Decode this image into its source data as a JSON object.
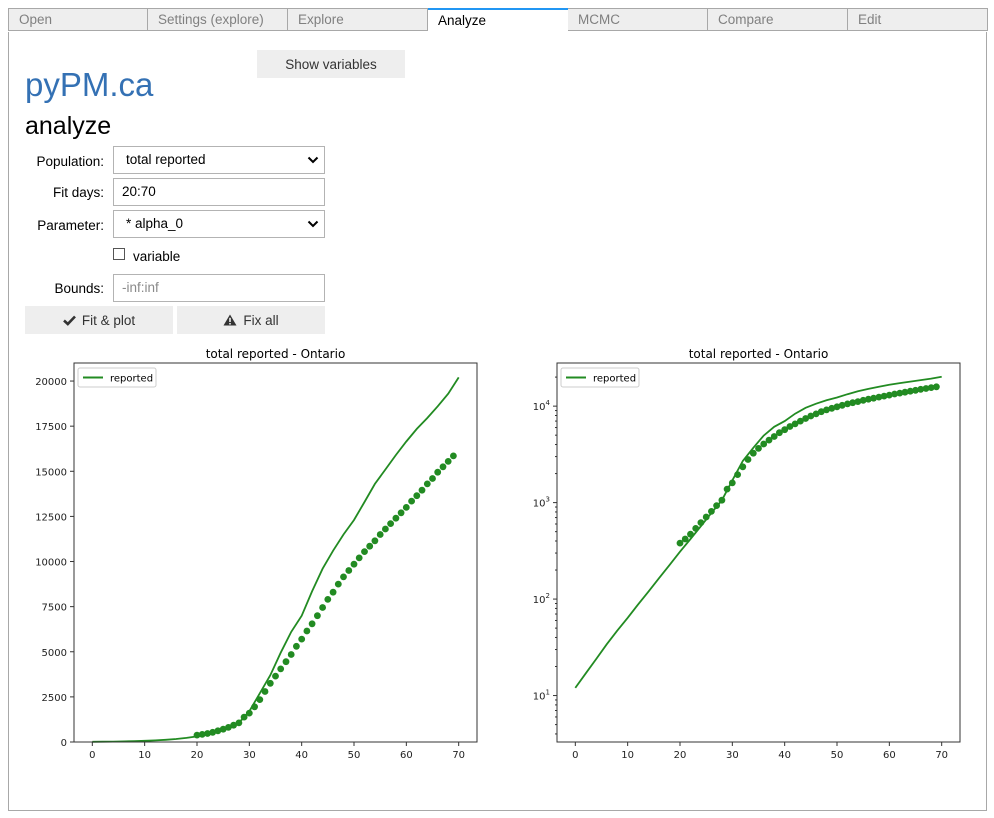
{
  "tabs": [
    {
      "label": "Open",
      "active": false
    },
    {
      "label": "Settings (explore)",
      "active": false
    },
    {
      "label": "Explore",
      "active": false
    },
    {
      "label": "Analyze",
      "active": true
    },
    {
      "label": "MCMC",
      "active": false
    },
    {
      "label": "Compare",
      "active": false
    },
    {
      "label": "Edit",
      "active": false
    }
  ],
  "header": {
    "brand": "pyPM.ca",
    "subtitle": "analyze",
    "show_variables_label": "Show variables"
  },
  "form": {
    "population_label": "Population:",
    "population_value": "total reported",
    "fit_days_label": "Fit days:",
    "fit_days_value": "20:70",
    "parameter_label": "Parameter:",
    "parameter_value": "* alpha_0",
    "variable_label": "variable",
    "variable_checked": false,
    "bounds_label": "Bounds:",
    "bounds_placeholder": "-inf:inf",
    "fit_plot_label": "Fit & plot",
    "fix_all_label": "Fix all"
  },
  "colors": {
    "accent": "#2196f3",
    "brand": "#3471b4",
    "series": "#228b22"
  },
  "chart_data": [
    {
      "type": "line",
      "title": "total reported - Ontario",
      "xlabel": "",
      "ylabel": "",
      "yscale": "linear",
      "xlim": [
        -3.5,
        73.5
      ],
      "ylim": [
        0,
        21000
      ],
      "xticks": [
        0,
        10,
        20,
        30,
        40,
        50,
        60,
        70
      ],
      "yticks": [
        0,
        2500,
        5000,
        7500,
        10000,
        12500,
        15000,
        17500,
        20000
      ],
      "ytick_labels": [
        "0",
        "2500",
        "5000",
        "7500",
        "10000",
        "12500",
        "15000",
        "17500",
        "20000"
      ],
      "legend": {
        "entries": [
          "reported"
        ],
        "placement": "top-left"
      },
      "grid": false
    },
    {
      "type": "line",
      "title": "total reported - Ontario",
      "xlabel": "",
      "ylabel": "",
      "yscale": "log",
      "xlim": [
        -3.5,
        73.5
      ],
      "ylim": [
        3.3,
        28000
      ],
      "xticks": [
        0,
        10,
        20,
        30,
        40,
        50,
        60,
        70
      ],
      "yticks": [
        10,
        100,
        1000,
        10000
      ],
      "ytick_labels": [
        "10^1",
        "10^2",
        "10^3",
        "10^4"
      ],
      "legend": {
        "entries": [
          "reported"
        ],
        "placement": "top-left"
      },
      "grid": false
    }
  ],
  "series": {
    "name": "reported",
    "model_x": [
      0,
      2,
      4,
      6,
      8,
      10,
      12,
      14,
      16,
      18,
      20,
      22,
      24,
      26,
      28,
      30,
      32,
      34,
      36,
      38,
      40,
      42,
      44,
      46,
      48,
      50,
      52,
      54,
      56,
      58,
      60,
      62,
      64,
      66,
      68,
      70
    ],
    "model_y": [
      12,
      17,
      24,
      34,
      47,
      64,
      88,
      120,
      165,
      225,
      310,
      420,
      570,
      780,
      1060,
      1700,
      2700,
      3700,
      4950,
      6100,
      7000,
      8350,
      9600,
      10600,
      11500,
      12300,
      13300,
      14300,
      15100,
      15900,
      16650,
      17350,
      17950,
      18600,
      19300,
      20200
    ],
    "data_x": [
      20,
      21,
      22,
      23,
      24,
      25,
      26,
      27,
      28,
      29,
      30,
      31,
      32,
      33,
      34,
      35,
      36,
      37,
      38,
      39,
      40,
      41,
      42,
      43,
      44,
      45,
      46,
      47,
      48,
      49,
      50,
      51,
      52,
      53,
      54,
      55,
      56,
      57,
      58,
      59,
      60,
      61,
      62,
      63,
      64,
      65,
      66,
      67,
      68,
      69
    ],
    "data_y": [
      380,
      420,
      470,
      540,
      620,
      710,
      810,
      930,
      1060,
      1380,
      1600,
      1950,
      2350,
      2800,
      3250,
      3650,
      4050,
      4450,
      4850,
      5300,
      5700,
      6150,
      6550,
      7000,
      7450,
      7900,
      8300,
      8750,
      9150,
      9500,
      9850,
      10200,
      10550,
      10850,
      11150,
      11500,
      11800,
      12100,
      12400,
      12700,
      13000,
      13350,
      13650,
      13950,
      14300,
      14600,
      14950,
      15250,
      15550,
      15850
    ]
  }
}
